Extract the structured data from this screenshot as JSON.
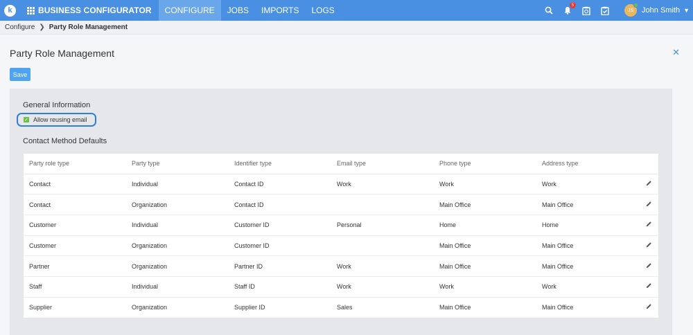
{
  "topnav": {
    "logo_letter": "k",
    "app_title": "BUSINESS CONFIGURATOR",
    "tabs": [
      {
        "label": "CONFIGURE",
        "active": true
      },
      {
        "label": "JOBS",
        "active": false
      },
      {
        "label": "IMPORTS",
        "active": false
      },
      {
        "label": "LOGS",
        "active": false
      }
    ],
    "notification_count": "5",
    "user_initials": "JS",
    "user_name": "John Smith",
    "accent_color": "#4a90e2"
  },
  "breadcrumb": {
    "parent": "Configure",
    "current": "Party Role Management"
  },
  "page": {
    "title": "Party Role Management",
    "save_label": "Save"
  },
  "general": {
    "title": "General Information",
    "allow_reuse_label": "Allow reusing email",
    "allow_reuse_checked": true
  },
  "contact_defaults": {
    "title": "Contact Method Defaults",
    "columns": [
      "Party role type",
      "Party type",
      "Identifier type",
      "Email type",
      "Phone type",
      "Address type"
    ],
    "rows": [
      [
        "Contact",
        "Individual",
        "Contact ID",
        "Work",
        "Work",
        "Work"
      ],
      [
        "Contact",
        "Organization",
        "Contact ID",
        "",
        "Main Office",
        "Main Office"
      ],
      [
        "Customer",
        "Individual",
        "Customer ID",
        "Personal",
        "Home",
        "Home"
      ],
      [
        "Customer",
        "Organization",
        "Customer ID",
        "",
        "Main Office",
        "Main Office"
      ],
      [
        "Partner",
        "Organization",
        "Partner ID",
        "Work",
        "Main Office",
        "Main Office"
      ],
      [
        "Staff",
        "Individual",
        "Staff ID",
        "Work",
        "Work",
        "Work"
      ],
      [
        "Supplier",
        "Organization",
        "Supplier ID",
        "Sales",
        "Main Office",
        "Main Office"
      ]
    ]
  }
}
